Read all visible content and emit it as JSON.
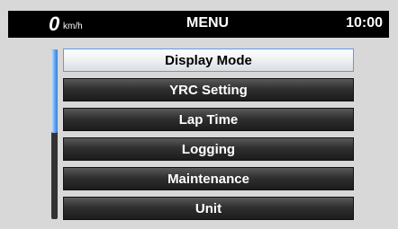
{
  "status": {
    "speed_value": "0",
    "speed_unit": "km/h",
    "title": "MENU",
    "time": "10:00"
  },
  "menu": {
    "items": [
      {
        "label": "Display Mode",
        "selected": true
      },
      {
        "label": "YRC Setting",
        "selected": false
      },
      {
        "label": "Lap Time",
        "selected": false
      },
      {
        "label": "Logging",
        "selected": false
      },
      {
        "label": "Maintenance",
        "selected": false
      },
      {
        "label": "Unit",
        "selected": false
      }
    ]
  },
  "scroll": {
    "position_fraction": 0.0,
    "visible_fraction": 0.49
  },
  "colors": {
    "selected_border": "#5a9de8",
    "scroll_thumb": "#5aa0ef",
    "status_bar": "#000000"
  }
}
